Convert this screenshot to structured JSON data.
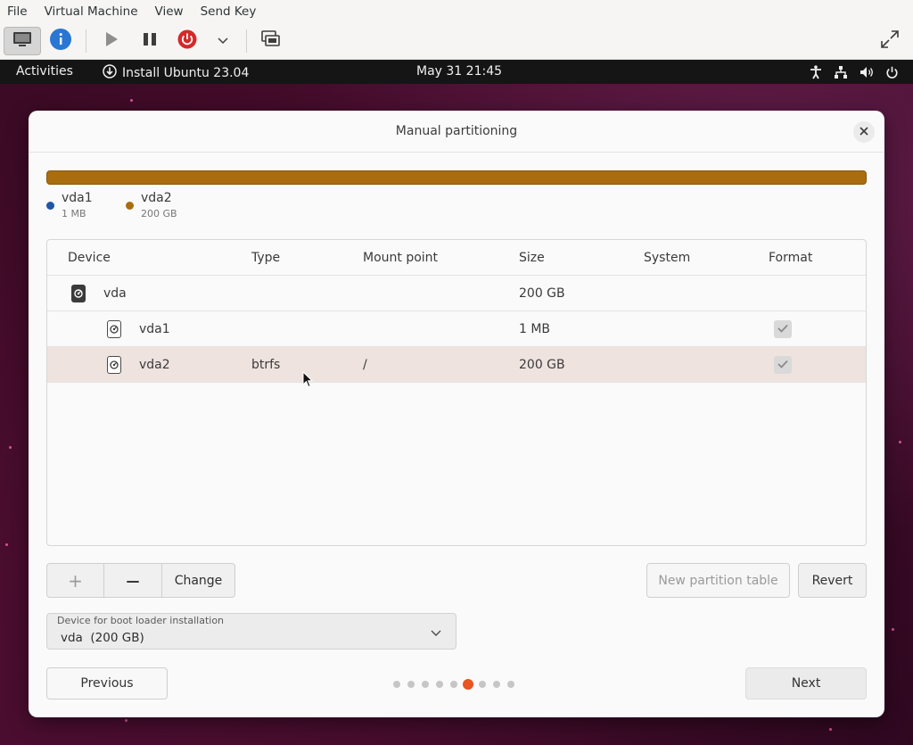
{
  "host": {
    "menu": [
      "File",
      "Virtual Machine",
      "View",
      "Send Key"
    ],
    "toolbar_icons": [
      "display-icon",
      "info-icon",
      "play-icon",
      "pause-icon",
      "power-icon",
      "chevron-down-icon",
      "screenshot-icon",
      "fullscreen-icon"
    ]
  },
  "guest_bar": {
    "activities": "Activities",
    "app_name": "Install Ubuntu 23.04",
    "clock": "May 31  21:45",
    "tray_icons": [
      "accessibility-icon",
      "network-icon",
      "volume-icon",
      "power-icon"
    ]
  },
  "dialog": {
    "title": "Manual partitioning",
    "usage_bar_color": "#a96d0f",
    "legend": [
      {
        "name": "vda1",
        "size": "1 MB",
        "color": "#1f55a8"
      },
      {
        "name": "vda2",
        "size": "200 GB",
        "color": "#a96d0f"
      }
    ],
    "table": {
      "headers": {
        "device": "Device",
        "type": "Type",
        "mount": "Mount point",
        "size": "Size",
        "system": "System",
        "format": "Format"
      },
      "rows": [
        {
          "device": "vda",
          "type": "",
          "mount": "",
          "size": "200 GB",
          "system": "",
          "format": null
        },
        {
          "device": "vda1",
          "type": "",
          "mount": "",
          "size": "1 MB",
          "system": "",
          "format": true
        },
        {
          "device": "vda2",
          "type": "btrfs",
          "mount": "/",
          "size": "200 GB",
          "system": "",
          "format": true,
          "selected": true
        }
      ]
    },
    "buttons": {
      "add": "+",
      "remove": "—",
      "change": "Change",
      "new_table": "New partition table",
      "revert": "Revert"
    },
    "boot_loader": {
      "label": "Device for boot loader installation",
      "value": "vda  (200 GB)"
    },
    "nav": {
      "previous": "Previous",
      "next": "Next",
      "pages": 9,
      "current_page": 6
    },
    "accent": "#e95420"
  }
}
